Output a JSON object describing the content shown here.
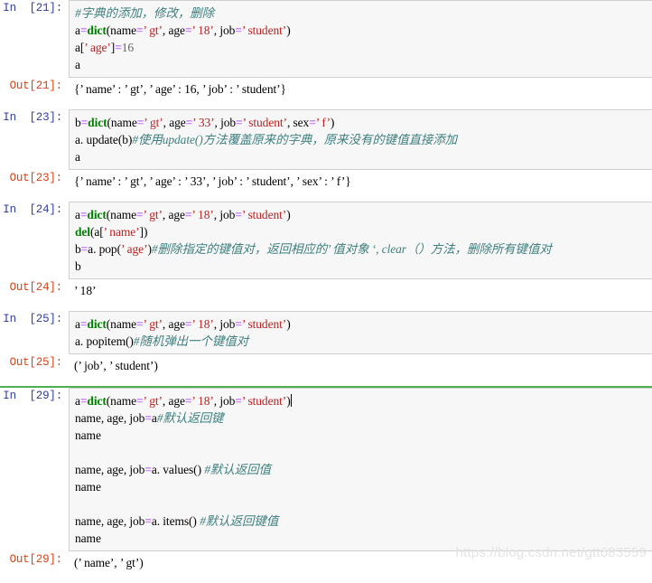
{
  "watermark": "https://blog.csdn.net/gtt683559",
  "colors": {
    "in_prompt": "#303f9f",
    "out_prompt": "#d84315",
    "keyword": "#008000",
    "operator": "#aa22ff",
    "string": "#ba2121",
    "comment": "#408080",
    "cell_background": "#f7f7f7",
    "cell_border": "#cfcfcf",
    "selection_highlight": "#dedede",
    "selected_cell_marker": "#4caf50",
    "watermark": "#e3e3e3"
  },
  "cells": [
    {
      "id": "cell-21",
      "in_prompt": "In  [21]:",
      "out_prompt": "Out[21]:",
      "selected": false,
      "code_lines": [
        [
          {
            "t": "#字典的添加，修改，删除",
            "c": "comment"
          }
        ],
        [
          {
            "t": "a",
            "c": "plain"
          },
          {
            "t": "=",
            "c": "op"
          },
          {
            "t": "dict",
            "c": "kw"
          },
          {
            "t": "(name",
            "c": "plain"
          },
          {
            "t": "=",
            "c": "op"
          },
          {
            "t": "’ gt’",
            "c": "str"
          },
          {
            "t": ", age",
            "c": "plain"
          },
          {
            "t": "=",
            "c": "op"
          },
          {
            "t": "’ 18’",
            "c": "str"
          },
          {
            "t": ", job",
            "c": "plain"
          },
          {
            "t": "=",
            "c": "op"
          },
          {
            "t": "’ student’",
            "c": "str"
          },
          {
            "t": ")",
            "c": "plain"
          }
        ],
        [
          {
            "t": "a[",
            "c": "plain"
          },
          {
            "t": "’ age’",
            "c": "str"
          },
          {
            "t": "]",
            "c": "plain"
          },
          {
            "t": "=",
            "c": "op"
          },
          {
            "t": "16",
            "c": "num"
          }
        ],
        [
          {
            "t": "a",
            "c": "plain"
          }
        ]
      ],
      "output_lines": [
        "{’ name’ : ’ gt’, ’ age’ : 16, ’ job’ : ’ student’}"
      ]
    },
    {
      "id": "cell-23",
      "in_prompt": "In  [23]:",
      "out_prompt": "Out[23]:",
      "selected": false,
      "code_lines": [
        [
          {
            "t": "b",
            "c": "plain"
          },
          {
            "t": "=",
            "c": "op"
          },
          {
            "t": "dict",
            "c": "kw"
          },
          {
            "t": "(name",
            "c": "plain"
          },
          {
            "t": "=",
            "c": "op"
          },
          {
            "t": "’ gt’",
            "c": "str"
          },
          {
            "t": ", age",
            "c": "plain"
          },
          {
            "t": "=",
            "c": "op"
          },
          {
            "t": "’ 33’",
            "c": "str"
          },
          {
            "t": ", job",
            "c": "plain"
          },
          {
            "t": "=",
            "c": "op"
          },
          {
            "t": "’ student’",
            "c": "str"
          },
          {
            "t": ", sex",
            "c": "plain"
          },
          {
            "t": "=",
            "c": "op"
          },
          {
            "t": "’ f’",
            "c": "str"
          },
          {
            "t": ")",
            "c": "plain"
          }
        ],
        [
          {
            "t": "a. update(b)",
            "c": "plain"
          },
          {
            "t": "#使用update()方法覆盖原来的字典，原来没有的键值直接添加",
            "c": "comment"
          }
        ],
        [
          {
            "t": "a",
            "c": "plain"
          }
        ]
      ],
      "output_lines": [
        "{’ name’ : ’ gt’, ’ age’ : ’ 33’, ’ job’ : ’ student’, ’ sex’ : ’ f’}"
      ]
    },
    {
      "id": "cell-24",
      "in_prompt": "In  [24]:",
      "out_prompt": "Out[24]:",
      "selected": false,
      "code_lines": [
        [
          {
            "t": "a",
            "c": "plain",
            "hl": true
          },
          {
            "t": "=",
            "c": "op",
            "hl": true
          },
          {
            "t": "dict",
            "c": "kw",
            "hl": true
          },
          {
            "t": "(name",
            "c": "plain",
            "hl": true
          },
          {
            "t": "=",
            "c": "op",
            "hl": true
          },
          {
            "t": "’ gt’",
            "c": "str",
            "hl": true
          },
          {
            "t": ", age",
            "c": "plain",
            "hl": true
          },
          {
            "t": "=",
            "c": "op",
            "hl": true
          },
          {
            "t": "’ 18’",
            "c": "str",
            "hl": true
          },
          {
            "t": ", job",
            "c": "plain",
            "hl": true
          },
          {
            "t": "=",
            "c": "op",
            "hl": true
          },
          {
            "t": "’ student’",
            "c": "str",
            "hl": true
          },
          {
            "t": ")",
            "c": "plain",
            "hl": true
          }
        ],
        [
          {
            "t": "del",
            "c": "kw"
          },
          {
            "t": "(a[",
            "c": "plain"
          },
          {
            "t": "’ name’",
            "c": "str"
          },
          {
            "t": "])",
            "c": "plain"
          }
        ],
        [
          {
            "t": "b",
            "c": "plain"
          },
          {
            "t": "=",
            "c": "op"
          },
          {
            "t": "a. pop(",
            "c": "plain"
          },
          {
            "t": "’ age’",
            "c": "str"
          },
          {
            "t": ")",
            "c": "plain"
          },
          {
            "t": "#删除指定的键值对，返回相应的’ 值对象 ‘, clear（）方法，删除所有键值对",
            "c": "comment"
          }
        ],
        [
          {
            "t": "b",
            "c": "plain"
          }
        ]
      ],
      "output_lines": [
        "’ 18’"
      ]
    },
    {
      "id": "cell-25",
      "in_prompt": "In  [25]:",
      "out_prompt": "Out[25]:",
      "selected": false,
      "code_lines": [
        [
          {
            "t": "a",
            "c": "plain",
            "hl": true
          },
          {
            "t": "=",
            "c": "op",
            "hl": true
          },
          {
            "t": "dict",
            "c": "kw",
            "hl": true
          },
          {
            "t": "(name",
            "c": "plain",
            "hl": true
          },
          {
            "t": "=",
            "c": "op",
            "hl": true
          },
          {
            "t": "’ gt’",
            "c": "str",
            "hl": true
          },
          {
            "t": ", age",
            "c": "plain",
            "hl": true
          },
          {
            "t": "=",
            "c": "op",
            "hl": true
          },
          {
            "t": "’ 18’",
            "c": "str",
            "hl": true
          },
          {
            "t": ", job",
            "c": "plain",
            "hl": true
          },
          {
            "t": "=",
            "c": "op",
            "hl": true
          },
          {
            "t": "’ student’",
            "c": "str",
            "hl": true
          },
          {
            "t": ")",
            "c": "plain",
            "hl": true
          }
        ],
        [
          {
            "t": "a. popitem()",
            "c": "plain"
          },
          {
            "t": "#随机弹出一个键值对",
            "c": "comment"
          }
        ]
      ],
      "output_lines": [
        "(’ job’, ’ student’)"
      ]
    },
    {
      "id": "cell-29",
      "in_prompt": "In  [29]:",
      "out_prompt": "Out[29]:",
      "selected": true,
      "code_lines": [
        [
          {
            "t": "a",
            "c": "plain"
          },
          {
            "t": "=",
            "c": "op"
          },
          {
            "t": "dict",
            "c": "kw"
          },
          {
            "t": "(name",
            "c": "plain"
          },
          {
            "t": "=",
            "c": "op"
          },
          {
            "t": "’ gt’",
            "c": "str"
          },
          {
            "t": ", age",
            "c": "plain"
          },
          {
            "t": "=",
            "c": "op"
          },
          {
            "t": "’ 18’",
            "c": "str"
          },
          {
            "t": ", job",
            "c": "plain"
          },
          {
            "t": "=",
            "c": "op"
          },
          {
            "t": "’ student’",
            "c": "str"
          },
          {
            "t": ")",
            "c": "plain"
          },
          {
            "t": "",
            "c": "caret"
          }
        ],
        [
          {
            "t": "name, age, job",
            "c": "plain"
          },
          {
            "t": "=",
            "c": "op"
          },
          {
            "t": "a",
            "c": "plain"
          },
          {
            "t": "#默认返回键",
            "c": "comment"
          }
        ],
        [
          {
            "t": "name",
            "c": "plain"
          }
        ],
        [
          {
            "t": "",
            "c": "blank"
          }
        ],
        [
          {
            "t": "name, age, job",
            "c": "plain"
          },
          {
            "t": "=",
            "c": "op"
          },
          {
            "t": "a. values() ",
            "c": "plain"
          },
          {
            "t": "#默认返回值",
            "c": "comment"
          }
        ],
        [
          {
            "t": "name",
            "c": "plain"
          }
        ],
        [
          {
            "t": "",
            "c": "blank"
          }
        ],
        [
          {
            "t": "name, age, job",
            "c": "plain"
          },
          {
            "t": "=",
            "c": "op"
          },
          {
            "t": "a. items() ",
            "c": "plain"
          },
          {
            "t": "#默认返回键值",
            "c": "comment"
          }
        ],
        [
          {
            "t": "name",
            "c": "plain"
          }
        ]
      ],
      "output_lines": [
        "(’ name’, ’ gt’)"
      ]
    }
  ]
}
